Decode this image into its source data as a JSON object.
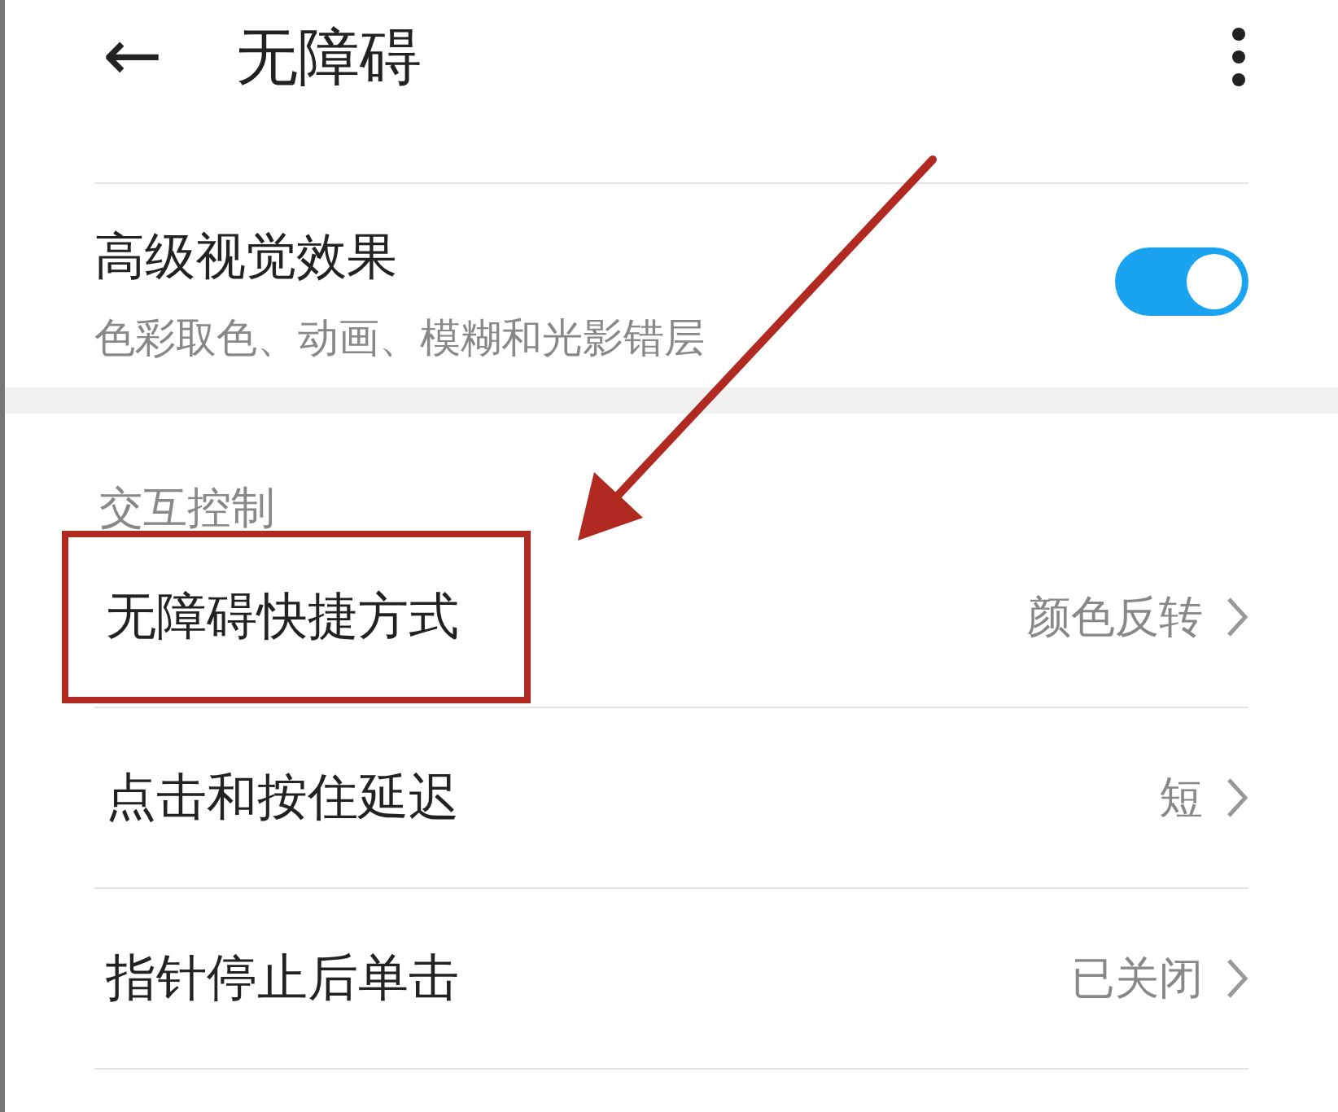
{
  "header": {
    "back_icon": "←",
    "title": "无障碍"
  },
  "visual": {
    "title": "高级视觉效果",
    "subtitle": "色彩取色、动画、模糊和光影错层",
    "on": true
  },
  "section": {
    "title": "交互控制"
  },
  "items": [
    {
      "label": "无障碍快捷方式",
      "value": "颜色反转",
      "highlighted": true
    },
    {
      "label": "点击和按住延迟",
      "value": "短",
      "highlighted": false
    },
    {
      "label": "指针停止后单击",
      "value": "已关闭",
      "highlighted": false
    }
  ],
  "annotation": {
    "arrow": true
  }
}
